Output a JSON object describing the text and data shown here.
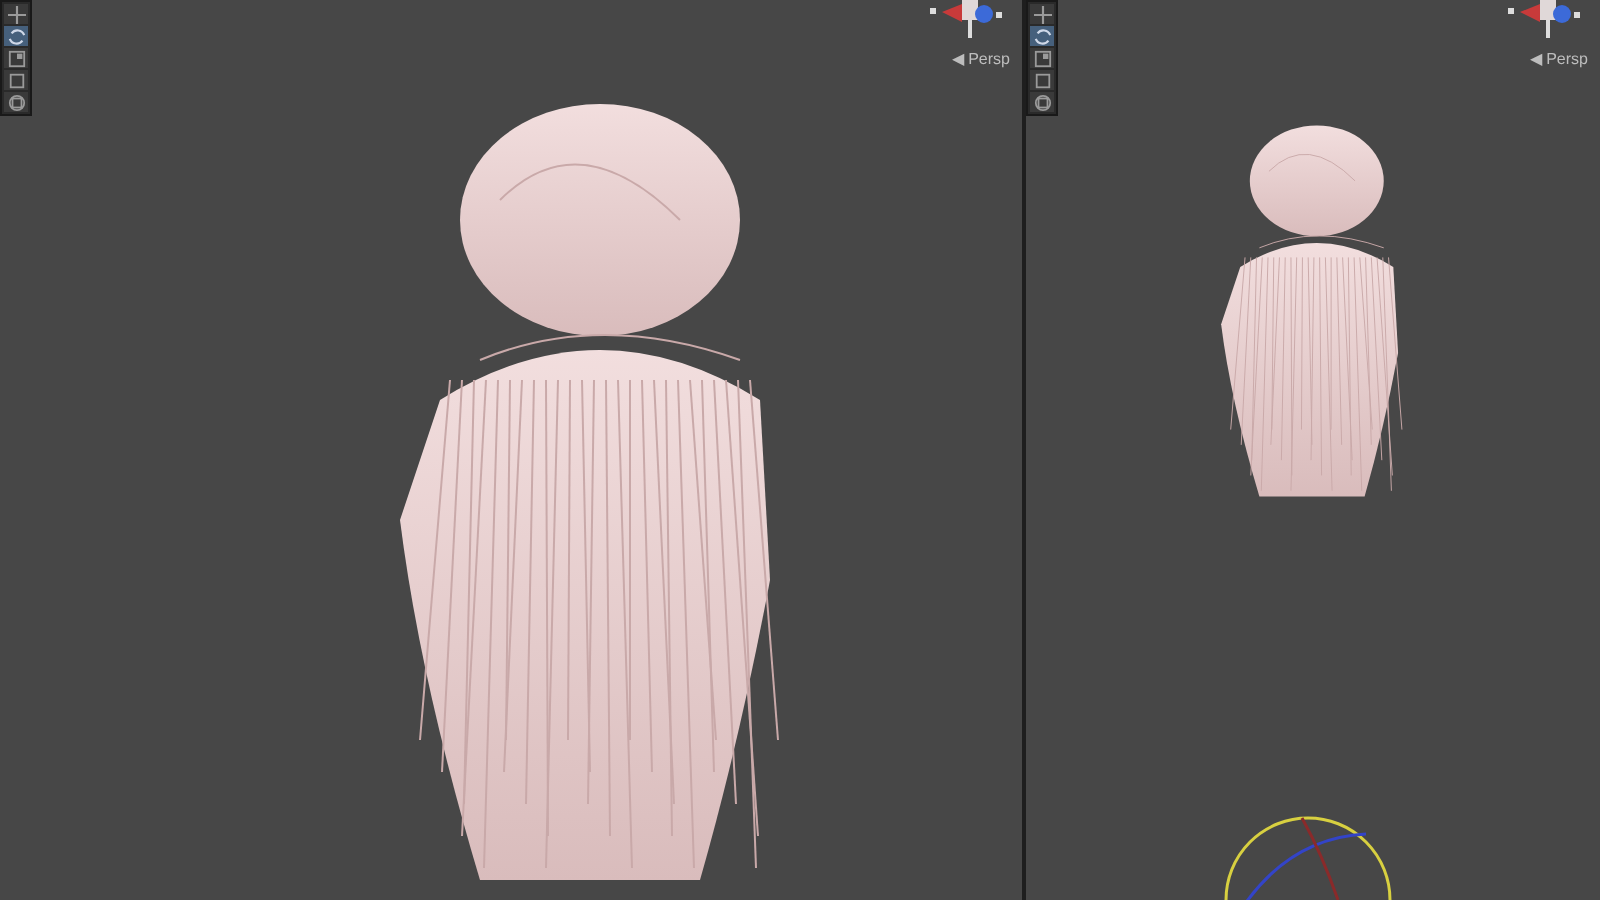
{
  "viewports": [
    {
      "tools": [
        {
          "kind": "move",
          "selected": false
        },
        {
          "kind": "rotate",
          "selected": true
        },
        {
          "kind": "scale",
          "selected": false
        },
        {
          "kind": "rect",
          "selected": false
        },
        {
          "kind": "transform",
          "selected": false
        }
      ],
      "projection": "◀ Persp",
      "rotate_gizmo": false
    },
    {
      "tools": [
        {
          "kind": "move",
          "selected": false
        },
        {
          "kind": "rotate",
          "selected": true
        },
        {
          "kind": "scale",
          "selected": false
        },
        {
          "kind": "rect",
          "selected": false
        },
        {
          "kind": "transform",
          "selected": false
        }
      ],
      "projection": "◀ Persp",
      "rotate_gizmo": true
    }
  ]
}
